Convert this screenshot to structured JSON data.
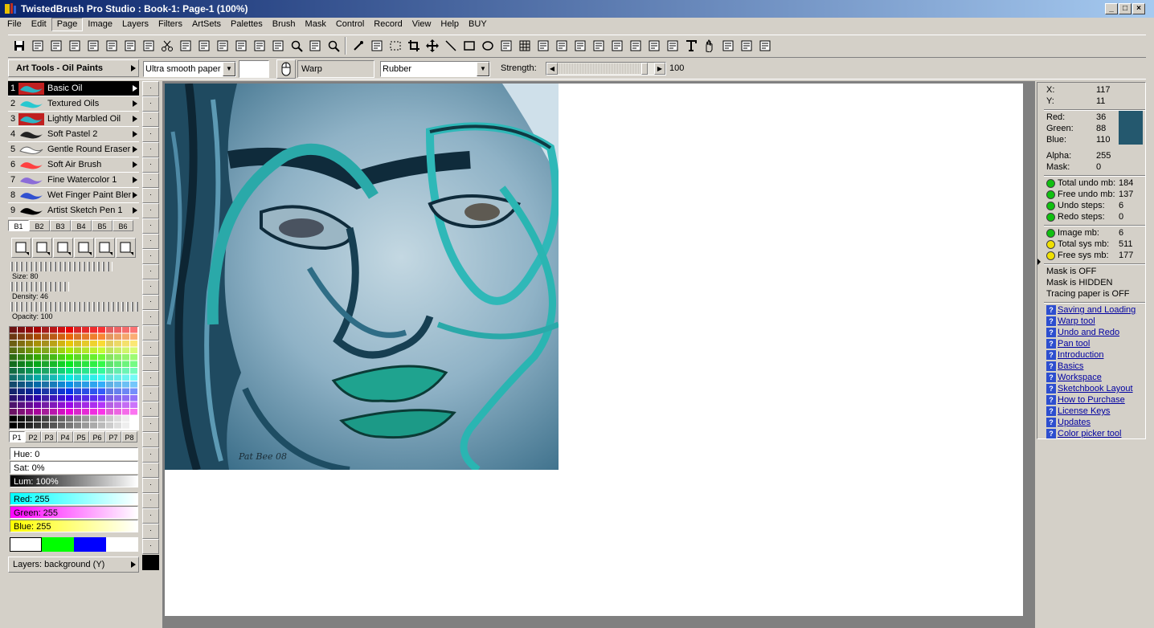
{
  "window": {
    "title": "TwistedBrush Pro Studio : Book-1: Page-1 (100%)",
    "btn_min": "_",
    "btn_max": "□",
    "btn_close": "×"
  },
  "menu": [
    "File",
    "Edit",
    "Page",
    "Image",
    "Layers",
    "Filters",
    "ArtSets",
    "Palettes",
    "Brush",
    "Mask",
    "Control",
    "Record",
    "View",
    "Help",
    "BUY"
  ],
  "toolbar_icons": [
    "save-icon",
    "save-as-icon",
    "new-page-icon",
    "prev-page-icon",
    "next-page-icon",
    "page-list-icon",
    "lightning-icon",
    "notes-icon",
    "cut-icon",
    "copy-icon",
    "paste-icon",
    "paste-special-icon",
    "paste-new-icon",
    "undo-icon",
    "redo-icon",
    "zoom-icon",
    "zoom-fit-icon",
    "zoom-out-icon",
    "eyedropper-icon",
    "bucket-icon",
    "select-rect-icon",
    "crop-icon",
    "move-icon",
    "line-icon",
    "rectangle-icon",
    "ellipse-icon",
    "fill-icon",
    "grid-icon",
    "pattern-icon",
    "sphere-icon",
    "hatch-icon",
    "lasso-icon",
    "pen-icon",
    "clone-icon",
    "stamp-icon",
    "texture-icon",
    "text-icon",
    "hand-icon",
    "rotate-icon",
    "tools-icon",
    "check-brush-icon"
  ],
  "options": {
    "art_tools_title": "Art Tools - Oil Paints",
    "paper": "Ultra smooth paper",
    "warp": "Warp",
    "mode": "Rubber",
    "strength_label": "Strength:",
    "strength": 100,
    "strength_fraction": 0.93
  },
  "brushes": [
    {
      "num": "1",
      "name": "Basic Oil",
      "color": "#2ab3c2"
    },
    {
      "num": "2",
      "name": "Textured Oils",
      "color": "#28c8d0"
    },
    {
      "num": "3",
      "name": "Lightly Marbled Oil",
      "color": "#2fb5c4"
    },
    {
      "num": "4",
      "name": "Soft Pastel 2",
      "color": "#222222"
    },
    {
      "num": "5",
      "name": "Gentle Round Eraser",
      "color": "#ffffff"
    },
    {
      "num": "6",
      "name": "Soft Air Brush",
      "color": "#ff4040"
    },
    {
      "num": "7",
      "name": "Fine Watercolor 1",
      "color": "#8b6cd8"
    },
    {
      "num": "8",
      "name": "Wet Finger Paint Blen",
      "color": "#3050d0"
    },
    {
      "num": "9",
      "name": "Artist Sketch Pen 1",
      "color": "#000000"
    }
  ],
  "banks": [
    "B1",
    "B2",
    "B3",
    "B4",
    "B5",
    "B6"
  ],
  "tool_buttons": [
    "shape-tool-icon",
    "rotate-brush-icon",
    "size-brush-icon",
    "square-brush-icon",
    "copy-brush-icon",
    "settings-brush-icon"
  ],
  "sliders": [
    {
      "label": "Size: 80",
      "value": 80
    },
    {
      "label": "Density: 46",
      "value": 46
    },
    {
      "label": "Opacity: 100",
      "value": 100
    }
  ],
  "palette_tabs": [
    "P1",
    "P2",
    "P3",
    "P4",
    "P5",
    "P6",
    "P7",
    "P8"
  ],
  "hsl": {
    "hue": "Hue: 0",
    "sat": "Sat: 0%",
    "lum": "Lum: 100%"
  },
  "rgb": {
    "red": "Red: 255",
    "green": "Green: 255",
    "blue": "Blue: 255"
  },
  "color_swatches": [
    "#ffffff",
    "#00ff00",
    "#0000ff",
    "#ffffff"
  ],
  "layers_label": "Layers: background (Y)",
  "info": {
    "x_label": "X:",
    "x": "117",
    "y_label": "Y:",
    "y": "11",
    "red_label": "Red:",
    "red": "36",
    "green_label": "Green:",
    "green": "88",
    "blue_label": "Blue:",
    "blue": "110",
    "picked_color": "#24586e",
    "alpha_label": "Alpha:",
    "alpha": "255",
    "mask_label": "Mask:",
    "mask": "0"
  },
  "memory": [
    {
      "label": "Total undo mb:",
      "value": "184",
      "color": "#10c010"
    },
    {
      "label": "Free undo mb:",
      "value": "137",
      "color": "#10c010"
    },
    {
      "label": "Undo steps:",
      "value": "6",
      "color": "#10c010"
    },
    {
      "label": "Redo steps:",
      "value": "0",
      "color": "#10c010"
    }
  ],
  "system": [
    {
      "label": "Image mb:",
      "value": "6",
      "color": "#10c010"
    },
    {
      "label": "Total sys mb:",
      "value": "511",
      "color": "#f0e000"
    },
    {
      "label": "Free sys mb:",
      "value": "177",
      "color": "#f0e000"
    }
  ],
  "status_lines": [
    "Mask is OFF",
    "Mask is HIDDEN",
    "Tracing paper is OFF"
  ],
  "help_links": [
    "Saving and Loading",
    "Warp tool",
    "Undo and Redo",
    "Pan tool",
    "Introduction",
    "Basics",
    "Workspace",
    "Sketchbook Layout",
    "How to Purchase",
    "License Keys",
    "Updates",
    "Color picker tool"
  ],
  "signature": "Pat Bee 08"
}
